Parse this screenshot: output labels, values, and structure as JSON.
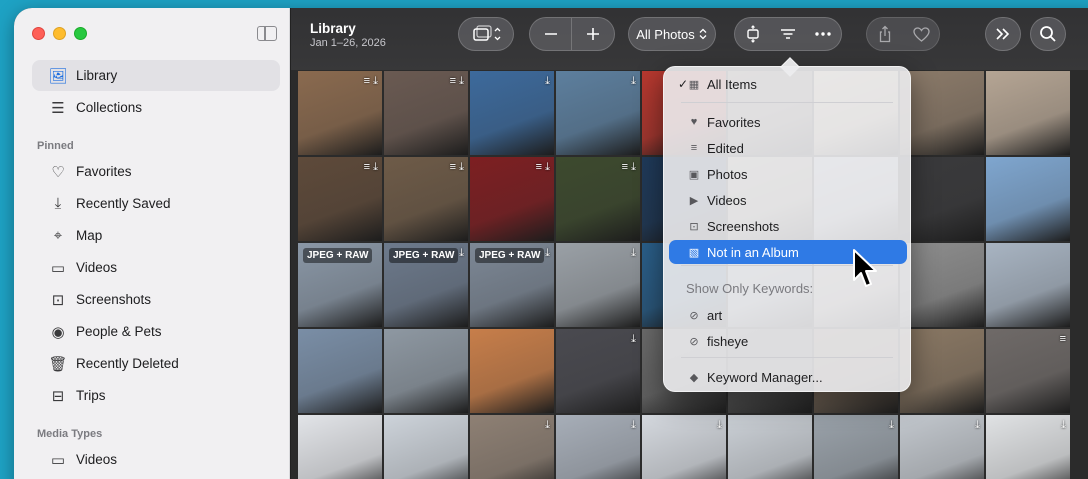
{
  "sidebar": {
    "items_top": [
      {
        "label": "Library",
        "icon": "photos-library-icon",
        "selected": true
      },
      {
        "label": "Collections",
        "icon": "collections-icon",
        "selected": false
      }
    ],
    "pinned_header": "Pinned",
    "pinned": [
      {
        "label": "Favorites",
        "icon": "heart-icon"
      },
      {
        "label": "Recently Saved",
        "icon": "download-icon"
      },
      {
        "label": "Map",
        "icon": "map-icon"
      },
      {
        "label": "Videos",
        "icon": "video-icon"
      },
      {
        "label": "Screenshots",
        "icon": "screenshot-icon"
      },
      {
        "label": "People & Pets",
        "icon": "person-icon"
      },
      {
        "label": "Recently Deleted",
        "icon": "trash-icon"
      },
      {
        "label": "Trips",
        "icon": "suitcase-icon"
      }
    ],
    "media_header": "Media Types",
    "media": [
      {
        "label": "Videos",
        "icon": "video-icon"
      }
    ]
  },
  "toolbar": {
    "title": "Library",
    "subtitle": "Jan 1–26, 2026",
    "filter_label": "All Photos"
  },
  "menu": {
    "all_items": "All Items",
    "items": [
      {
        "label": "Favorites",
        "icon": "heart-icon"
      },
      {
        "label": "Edited",
        "icon": "sliders-icon"
      },
      {
        "label": "Photos",
        "icon": "photo-icon"
      },
      {
        "label": "Videos",
        "icon": "video-icon"
      },
      {
        "label": "Screenshots",
        "icon": "screenshot-icon"
      },
      {
        "label": "Not in an Album",
        "icon": "no-album-icon",
        "highlight": true
      }
    ],
    "keywords_heading": "Show Only Keywords:",
    "keywords": [
      "art",
      "fisheye"
    ],
    "manager": "Keyword Manager..."
  },
  "grid": {
    "badge_text": "JPEG + RAW",
    "colors": [
      "#8a6a4f",
      "#6a5a52",
      "#3d6a9c",
      "#5d7f9e",
      "#b8382f",
      "#7a6e62",
      "#c9b89a",
      "#8c7b6a",
      "#b5a594",
      "#5e4a3a",
      "#6e5b48",
      "#7d1f22",
      "#3d4a2e",
      "#1f3a5a",
      "#a19a8a",
      "#b3b9c4",
      "#3a3a3c",
      "#7fa6cf",
      "#8a97a6",
      "#6d7a8c",
      "#7d8896",
      "#9aa0a6",
      "#2a5f8a",
      "#9aa4ae",
      "#b0a8a0",
      "#8e8e8e",
      "#a8b4c2",
      "#7a8ea6",
      "#8e98a2",
      "#c77e4a",
      "#4a4a50",
      "#6a6a6a",
      "#5a5a5a",
      "#7a6a5a",
      "#8a7864",
      "#6f6a68",
      "#e2e4e8",
      "#cdd3da",
      "#8e8074",
      "#a7aeb8",
      "#d4d8de",
      "#cbd0d6",
      "#9aa2aa",
      "#c2c7cd",
      "#e0e2e4"
    ],
    "badges": [
      18,
      19,
      20
    ],
    "edited": [
      0,
      1,
      9,
      10,
      11,
      12,
      35
    ],
    "saved": [
      0,
      1,
      2,
      3,
      9,
      10,
      11,
      12,
      19,
      20,
      21,
      23,
      30,
      38,
      39,
      40,
      42,
      43,
      44
    ]
  }
}
